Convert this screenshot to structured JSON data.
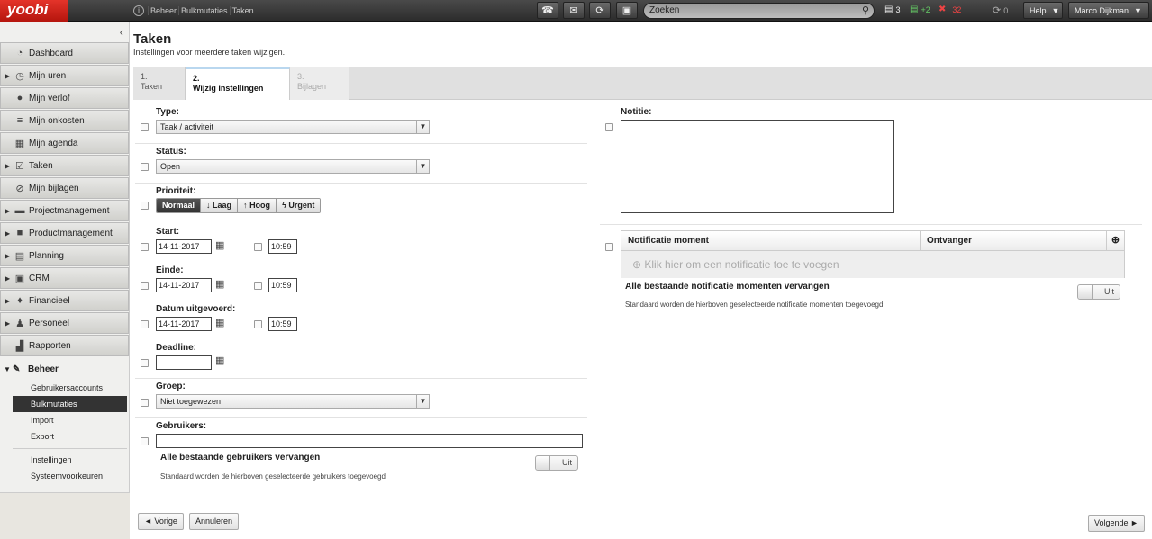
{
  "topbar": {
    "logo": "yoobi",
    "breadcrumb": [
      "Beheer",
      "Bulkmutaties",
      "Taken"
    ],
    "search_placeholder": "Zoeken",
    "count_tasks": "3",
    "count_plus": "+2",
    "count_minus": "32",
    "count_sync": "0",
    "help_label": "Help",
    "user_name": "Marco Dijkman"
  },
  "sidebar": {
    "items": [
      {
        "label": "Dashboard",
        "icon": "dashboard-icon"
      },
      {
        "label": "Mijn uren",
        "icon": "clock-icon"
      },
      {
        "label": "Mijn verlof",
        "icon": "piggybank-icon"
      },
      {
        "label": "Mijn onkosten",
        "icon": "coins-icon"
      },
      {
        "label": "Mijn agenda",
        "icon": "calendar-icon"
      },
      {
        "label": "Taken",
        "icon": "tasks-icon"
      },
      {
        "label": "Mijn bijlagen",
        "icon": "paperclip-icon"
      },
      {
        "label": "Projectmanagement",
        "icon": "briefcase-icon"
      },
      {
        "label": "Productmanagement",
        "icon": "box-icon"
      },
      {
        "label": "Planning",
        "icon": "planning-icon"
      },
      {
        "label": "CRM",
        "icon": "contact-icon"
      },
      {
        "label": "Financieel",
        "icon": "money-bag-icon"
      },
      {
        "label": "Personeel",
        "icon": "people-icon"
      },
      {
        "label": "Rapporten",
        "icon": "chart-icon"
      }
    ],
    "section_title": "Beheer",
    "sub_items": [
      "Gebruikersaccounts",
      "Bulkmutaties",
      "Import",
      "Export"
    ],
    "sub_items2": [
      "Instellingen",
      "Systeemvoorkeuren"
    ]
  },
  "page": {
    "title": "Taken",
    "subtitle": "Instellingen voor meerdere taken wijzigen."
  },
  "steps": [
    {
      "num": "1.",
      "label": "Taken"
    },
    {
      "num": "2.",
      "label": "Wijzig instellingen"
    },
    {
      "num": "3.",
      "label": "Bijlagen"
    }
  ],
  "form": {
    "type_label": "Type:",
    "type_value": "Taak / activiteit",
    "status_label": "Status:",
    "status_value": "Open",
    "priority_label": "Prioriteit:",
    "priority_options": [
      "Normaal",
      "Laag",
      "Hoog",
      "Urgent"
    ],
    "start_label": "Start:",
    "start_date": "14-11-2017",
    "start_time": "10:59",
    "end_label": "Einde:",
    "end_date": "14-11-2017",
    "end_time": "10:59",
    "done_label": "Datum uitgevoerd:",
    "done_date": "14-11-2017",
    "done_time": "10:59",
    "deadline_label": "Deadline:",
    "deadline_value": "",
    "group_label": "Groep:",
    "group_value": "Niet toegewezen",
    "users_label": "Gebruikers:",
    "replace_users_label": "Alle bestaande gebruikers vervangen",
    "replace_users_toggle": "Uit",
    "replace_users_desc": "Standaard worden de hierboven geselecteerde gebruikers toegevoegd",
    "note_label": "Notitie:",
    "notif_col1": "Notificatie moment",
    "notif_col2": "Ontvanger",
    "notif_add": "Klik hier om een notificatie toe te voegen",
    "replace_notif_label": "Alle bestaande notificatie momenten vervangen",
    "replace_notif_toggle": "Uit",
    "replace_notif_desc": "Standaard worden de hierboven geselecteerde notificatie momenten toegevoegd"
  },
  "footer": {
    "prev": "◄ Vorige",
    "cancel": "Annuleren",
    "next": "Volgende ►"
  }
}
